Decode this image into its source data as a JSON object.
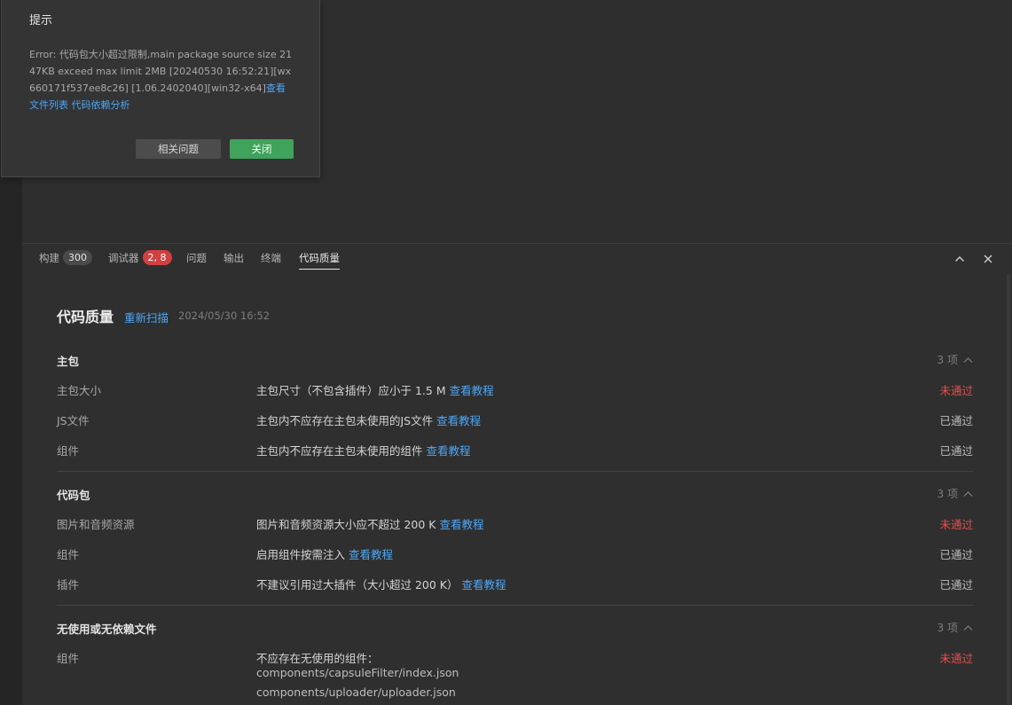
{
  "dialog": {
    "title": "提示",
    "message": "Error: 代码包大小超过限制,main package source size 2147KB exceed max limit 2MB [20240530 16:52:21][wx660171f537ee8c26] [1.06.2402040][win32-x64]",
    "link_file_list": "查看文件列表",
    "link_dependency": "代码依赖分析",
    "btn_related": "相关问题",
    "btn_close": "关闭"
  },
  "tabs": [
    {
      "label": "构建",
      "badge": "300"
    },
    {
      "label": "调试器",
      "badge": "2, 8"
    },
    {
      "label": "问题"
    },
    {
      "label": "输出"
    },
    {
      "label": "终端"
    },
    {
      "label": "代码质量",
      "active": true
    }
  ],
  "icons": {
    "collapse": "chevron-up-icon",
    "close": "close-icon"
  },
  "quality": {
    "title": "代码质量",
    "rescan": "重新扫描",
    "time": "2024/05/30 16:52",
    "sections": [
      {
        "title": "主包",
        "count": "3 项",
        "rows": [
          {
            "name": "主包大小",
            "desc": "主包尺寸（不包含插件）应小于 1.5 M",
            "link": "查看教程",
            "status": "未通过"
          },
          {
            "name": "JS文件",
            "desc": "主包内不应存在主包未使用的JS文件",
            "link": "查看教程",
            "status": "已通过"
          },
          {
            "name": "组件",
            "desc": "主包内不应存在主包未使用的组件",
            "link": "查看教程",
            "status": "已通过"
          }
        ]
      },
      {
        "title": "代码包",
        "count": "3 项",
        "rows": [
          {
            "name": "图片和音频资源",
            "desc": "图片和音频资源大小应不超过 200 K",
            "link": "查看教程",
            "status": "未通过"
          },
          {
            "name": "组件",
            "desc": "启用组件按需注入",
            "link": "查看教程",
            "status": "已通过"
          },
          {
            "name": "插件",
            "desc": "不建议引用过大插件（大小超过 200 K）",
            "link": "查看教程",
            "status": "已通过"
          }
        ]
      },
      {
        "title": "无使用或无依赖文件",
        "count": "3 项",
        "rows": [
          {
            "name": "组件",
            "desc": "不应存在无使用的组件：",
            "status": "未通过",
            "files": [
              "components/capsuleFilter/index.json",
              "components/uploader/uploader.json"
            ]
          }
        ]
      }
    ]
  },
  "colors": {
    "link": "#4ea6f5",
    "fail": "#e74c4c",
    "pass": "#bcbcbc",
    "close_button": "#3fa35c",
    "badge_red": "#d04040"
  }
}
